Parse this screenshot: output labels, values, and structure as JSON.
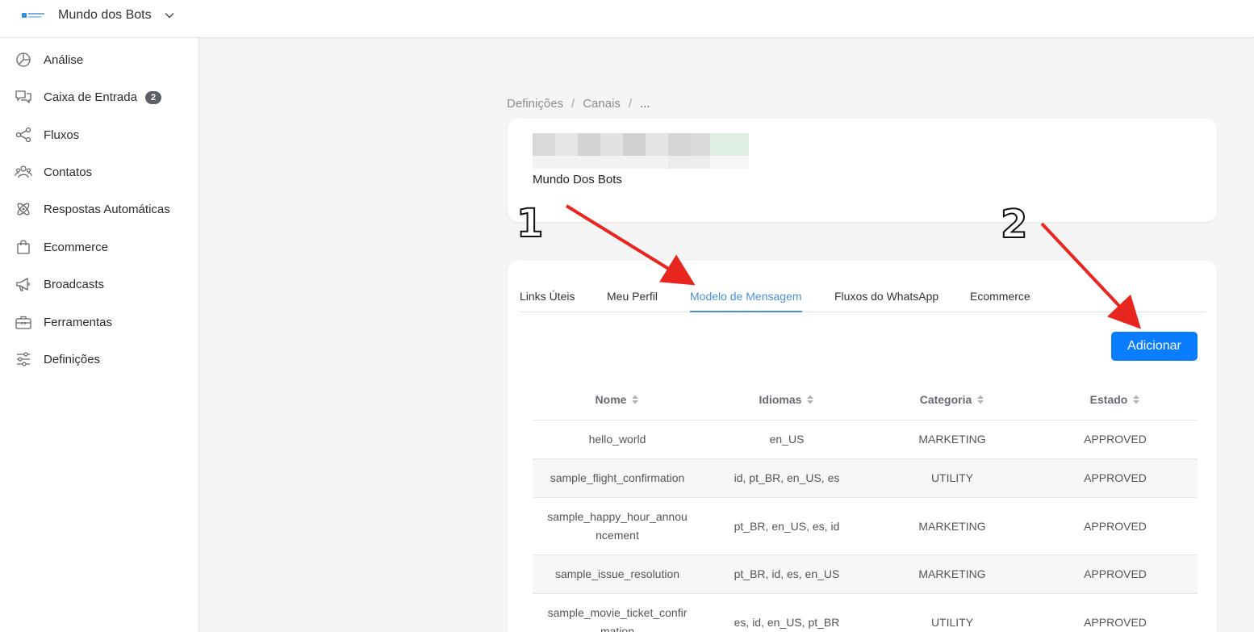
{
  "header": {
    "workspace_name": "Mundo dos Bots"
  },
  "sidebar": {
    "items": [
      {
        "label": "Análise",
        "icon": "pie-chart-icon"
      },
      {
        "label": "Caixa de Entrada",
        "icon": "chat-bubbles-icon",
        "badge": "2"
      },
      {
        "label": "Fluxos",
        "icon": "flow-nodes-icon"
      },
      {
        "label": "Contatos",
        "icon": "contacts-icon"
      },
      {
        "label": "Respostas Automáticas",
        "icon": "atom-icon"
      },
      {
        "label": "Ecommerce",
        "icon": "shopping-bag-icon"
      },
      {
        "label": "Broadcasts",
        "icon": "megaphone-icon"
      },
      {
        "label": "Ferramentas",
        "icon": "toolbox-icon"
      },
      {
        "label": "Definições",
        "icon": "sliders-icon"
      }
    ]
  },
  "breadcrumb": {
    "items": [
      "Definições",
      "Canais",
      "..."
    ],
    "separator": "/"
  },
  "channel": {
    "name": "Mundo Dos Bots"
  },
  "tabs": [
    {
      "label": "Links Úteis",
      "active": false
    },
    {
      "label": "Meu Perfil",
      "active": false
    },
    {
      "label": "Modelo de Mensagem",
      "active": true
    },
    {
      "label": "Fluxos do WhatsApp",
      "active": false
    },
    {
      "label": "Ecommerce",
      "active": false
    }
  ],
  "add_button": {
    "label": "Adicionar"
  },
  "table": {
    "columns": [
      "Nome",
      "Idiomas",
      "Categoria",
      "Estado"
    ],
    "rows": [
      {
        "name": "hello_world",
        "languages": "en_US",
        "category": "MARKETING",
        "status": "APPROVED"
      },
      {
        "name": "sample_flight_confirmation",
        "languages": "id, pt_BR, en_US, es",
        "category": "UTILITY",
        "status": "APPROVED"
      },
      {
        "name": "sample_happy_hour_announcement",
        "languages": "pt_BR, en_US, es, id",
        "category": "MARKETING",
        "status": "APPROVED"
      },
      {
        "name": "sample_issue_resolution",
        "languages": "pt_BR, id, es, en_US",
        "category": "MARKETING",
        "status": "APPROVED"
      },
      {
        "name": "sample_movie_ticket_confirmation",
        "languages": "es, id, en_US, pt_BR",
        "category": "UTILITY",
        "status": "APPROVED"
      }
    ]
  },
  "annotations": {
    "marker_1": "1",
    "marker_2": "2",
    "arrow_color": "#e8251f"
  },
  "colors": {
    "accent_blue": "#0a7cff",
    "active_tab": "#4a90d9",
    "badge": "#5c6066"
  }
}
